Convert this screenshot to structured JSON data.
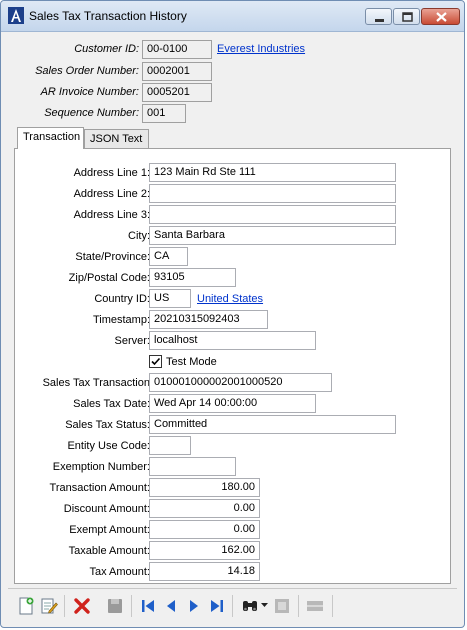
{
  "window": {
    "title": "Sales Tax Transaction History",
    "accent_color": "#c94b34"
  },
  "header": {
    "customer_id_label": "Customer ID:",
    "customer_id": "00-0100",
    "customer_name": "Everest Industries",
    "sales_order_label": "Sales Order Number:",
    "sales_order": "0002001",
    "ar_invoice_label": "AR Invoice Number:",
    "ar_invoice": "0005201",
    "sequence_label": "Sequence Number:",
    "sequence": "001"
  },
  "tabs": [
    {
      "label": "Transaction",
      "active": true
    },
    {
      "label": "JSON Text",
      "active": false
    }
  ],
  "form": {
    "address1_label": "Address Line 1:",
    "address1": "123 Main Rd Ste 111",
    "address2_label": "Address Line 2:",
    "address2": "",
    "address3_label": "Address Line 3:",
    "address3": "",
    "city_label": "City:",
    "city": "Santa Barbara",
    "state_label": "State/Province:",
    "state": "CA",
    "zip_label": "Zip/Postal Code:",
    "zip": "93105",
    "country_label": "Country ID:",
    "country_id": "US",
    "country_name": "United States",
    "timestamp_label": "Timestamp:",
    "timestamp": "20210315092403",
    "server_label": "Server:",
    "server": "localhost",
    "test_mode_label": "Test Mode",
    "test_mode_checked": true,
    "sales_tax_txn_label": "Sales Tax Transaction",
    "sales_tax_txn": "010001000002001000520",
    "sales_tax_date_label": "Sales Tax Date:",
    "sales_tax_date": "Wed Apr 14 00:00:00",
    "sales_tax_status_label": "Sales Tax Status:",
    "sales_tax_status": "Committed",
    "entity_use_label": "Entity Use Code:",
    "entity_use": "",
    "exemption_label": "Exemption Number:",
    "exemption": "",
    "txn_amount_label": "Transaction Amount:",
    "txn_amount": "180.00",
    "discount_amount_label": "Discount Amount:",
    "discount_amount": "0.00",
    "exempt_amount_label": "Exempt Amount:",
    "exempt_amount": "0.00",
    "taxable_amount_label": "Taxable Amount:",
    "taxable_amount": "162.00",
    "tax_amount_label": "Tax Amount:",
    "tax_amount": "14.18"
  },
  "toolbar": {
    "icons": [
      "new-icon",
      "edit-icon",
      "delete-icon",
      "save-icon",
      "first-record-icon",
      "previous-record-icon",
      "next-record-icon",
      "last-record-icon",
      "lookup-icon",
      "dropdown-icon",
      "disabled-icon",
      "disabled-icon"
    ]
  }
}
